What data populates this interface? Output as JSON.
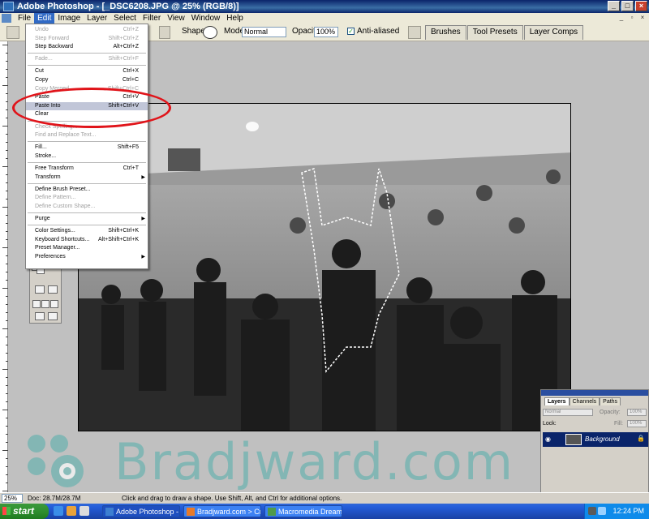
{
  "window": {
    "title": "Adobe Photoshop - [_DSC6208.JPG @ 25% (RGB/8)]"
  },
  "menubar": {
    "items": [
      "File",
      "Edit",
      "Image",
      "Layer",
      "Select",
      "Filter",
      "View",
      "Window",
      "Help"
    ],
    "active": "Edit"
  },
  "options": {
    "shape_label": "Shape:",
    "mode_label": "Mode:",
    "mode_value": "Normal",
    "opacity_label": "Opacity:",
    "opacity_value": "100%",
    "antialiased_label": "Anti-aliased",
    "palette_tabs": [
      "Brushes",
      "Tool Presets",
      "Layer Comps"
    ]
  },
  "edit_menu": {
    "items": [
      {
        "label": "Undo",
        "shortcut": "Ctrl+Z",
        "disabled": true
      },
      {
        "label": "Step Forward",
        "shortcut": "Shift+Ctrl+Z",
        "disabled": true
      },
      {
        "label": "Step Backward",
        "shortcut": "Alt+Ctrl+Z",
        "disabled": false
      },
      {
        "label": "Fade...",
        "shortcut": "Shift+Ctrl+F",
        "disabled": true
      },
      {
        "label": "Cut",
        "shortcut": "Ctrl+X",
        "disabled": false
      },
      {
        "label": "Copy",
        "shortcut": "Ctrl+C",
        "disabled": false
      },
      {
        "label": "Copy Merged",
        "shortcut": "Shift+Ctrl+C",
        "disabled": true
      },
      {
        "label": "Paste",
        "shortcut": "Ctrl+V",
        "disabled": false
      },
      {
        "label": "Paste Into",
        "shortcut": "Shift+Ctrl+V",
        "disabled": false,
        "highlighted": true
      },
      {
        "label": "Clear",
        "shortcut": "",
        "disabled": false
      },
      {
        "label": "Check Spelling...",
        "shortcut": "",
        "disabled": true
      },
      {
        "label": "Find and Replace Text...",
        "shortcut": "",
        "disabled": true
      },
      {
        "label": "Fill...",
        "shortcut": "Shift+F5",
        "disabled": false
      },
      {
        "label": "Stroke...",
        "shortcut": "",
        "disabled": false
      },
      {
        "label": "Free Transform",
        "shortcut": "Ctrl+T",
        "disabled": false
      },
      {
        "label": "Transform",
        "shortcut": "",
        "disabled": false,
        "submenu": true
      },
      {
        "label": "Define Brush Preset...",
        "shortcut": "",
        "disabled": false
      },
      {
        "label": "Define Pattern...",
        "shortcut": "",
        "disabled": true
      },
      {
        "label": "Define Custom Shape...",
        "shortcut": "",
        "disabled": true
      },
      {
        "label": "Purge",
        "shortcut": "",
        "disabled": false,
        "submenu": true
      },
      {
        "label": "Color Settings...",
        "shortcut": "Shift+Ctrl+K",
        "disabled": false
      },
      {
        "label": "Keyboard Shortcuts...",
        "shortcut": "Alt+Shift+Ctrl+K",
        "disabled": false
      },
      {
        "label": "Preset Manager...",
        "shortcut": "",
        "disabled": false
      },
      {
        "label": "Preferences",
        "shortcut": "",
        "disabled": false,
        "submenu": true
      }
    ],
    "separators_after": [
      2,
      3,
      9,
      11,
      13,
      15,
      18,
      19
    ]
  },
  "layers": {
    "tabs": [
      "Layers",
      "Channels",
      "Paths"
    ],
    "blend_mode": "Normal",
    "opacity_label": "Opacity:",
    "opacity_value": "100%",
    "lock_label": "Lock:",
    "fill_label": "Fill:",
    "fill_value": "100%",
    "layer_name": "Background"
  },
  "watermark": {
    "text": "Bradjward.com"
  },
  "status": {
    "zoom": "25%",
    "doc": "Doc: 28.7M/28.7M",
    "hint": "Click and drag to draw a shape. Use Shift, Alt, and Ctrl for additional options."
  },
  "taskbar": {
    "start": "start",
    "buttons": [
      "Adobe Photoshop - [...",
      "Bradjward.com > Cre...",
      "Macromedia Dreamw..."
    ],
    "clock": "12:24 PM"
  }
}
